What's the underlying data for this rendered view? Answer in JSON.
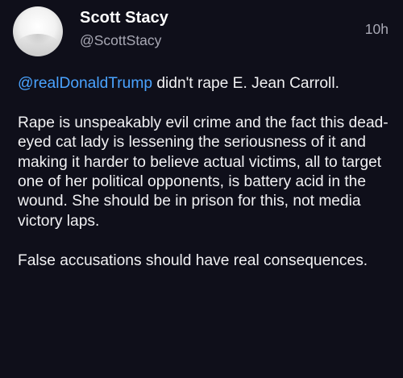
{
  "author": {
    "display_name": "Scott Stacy",
    "handle": "@ScottStacy",
    "avatar_icon": "profile-photo",
    "timestamp": "10h"
  },
  "post": {
    "mention": "@realDonaldTrump",
    "paragraph_1_rest": " didn't rape E. Jean Carroll.",
    "paragraph_2": "Rape is unspeakably evil crime and the fact this dead-eyed cat lady is lessening the seriousness of it and making it harder to believe actual victims, all to target one of her political opponents, is battery acid in the wound. She should be in prison for this, not media victory laps.",
    "paragraph_3": "False accusations should have real consequences."
  },
  "colors": {
    "background": "#0f0f1a",
    "text": "#f1f1f3",
    "muted": "#a8a8b4",
    "mention": "#4aa3ff"
  }
}
